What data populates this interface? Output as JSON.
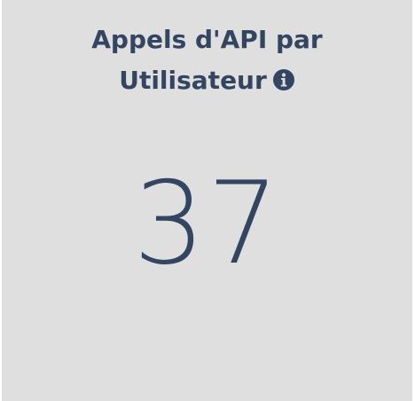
{
  "widget": {
    "title_line1": "Appels d'API par",
    "title_line2": "Utilisateur",
    "info_icon": "info-circle-icon",
    "value": "37"
  },
  "colors": {
    "card_background": "#dfdfdf",
    "text": "#334560"
  }
}
